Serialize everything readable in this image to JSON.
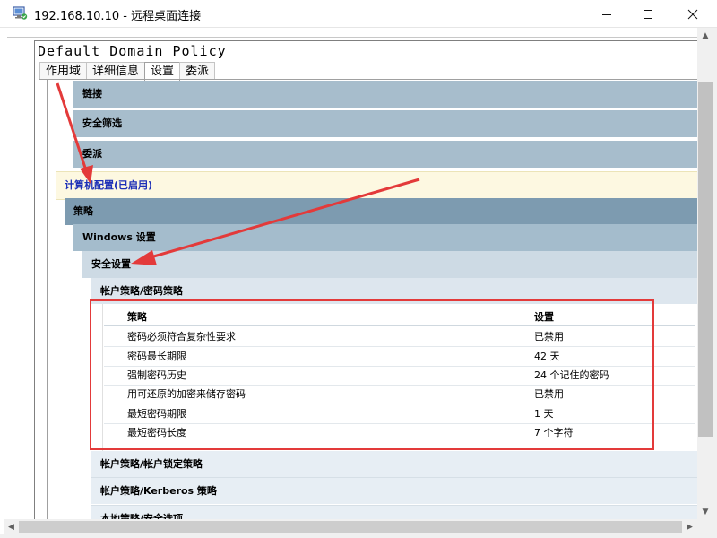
{
  "window": {
    "title": "192.168.10.10 - 远程桌面连接",
    "app_icon": "remote-desktop-icon",
    "controls": [
      "minimize-icon",
      "maximize-icon",
      "close-icon"
    ]
  },
  "report": {
    "title": "Default Domain Policy",
    "tabs": [
      {
        "label": "作用域",
        "active": false
      },
      {
        "label": "详细信息",
        "active": false
      },
      {
        "label": "设置",
        "active": true
      },
      {
        "label": "委派",
        "active": false
      }
    ],
    "sections": {
      "links": "链接",
      "security_filtering": "安全筛选",
      "delegation": "委派",
      "computer_config": "计算机配置(已启用)",
      "policies": "策略",
      "windows_settings": "Windows 设置",
      "security_settings": "安全设置",
      "password_policy": "帐户策略/密码策略",
      "lockout_policy": "帐户策略/帐户锁定策略",
      "kerberos_policy": "帐户策略/Kerberos 策略",
      "local_policy": "本地策略/安全选项"
    },
    "table": {
      "headers": {
        "policy": "策略",
        "setting": "设置"
      },
      "rows": [
        {
          "policy": "密码必须符合复杂性要求",
          "setting": "已禁用"
        },
        {
          "policy": "密码最长期限",
          "setting": "42 天"
        },
        {
          "policy": "强制密码历史",
          "setting": "24 个记住的密码"
        },
        {
          "policy": "用可还原的加密来储存密码",
          "setting": "已禁用"
        },
        {
          "policy": "最短密码期限",
          "setting": "1 天"
        },
        {
          "policy": "最短密码长度",
          "setting": "7 个字符"
        }
      ]
    }
  },
  "colors": {
    "annotation": "#e33a3a",
    "enabled_text": "#1c2fb7"
  }
}
